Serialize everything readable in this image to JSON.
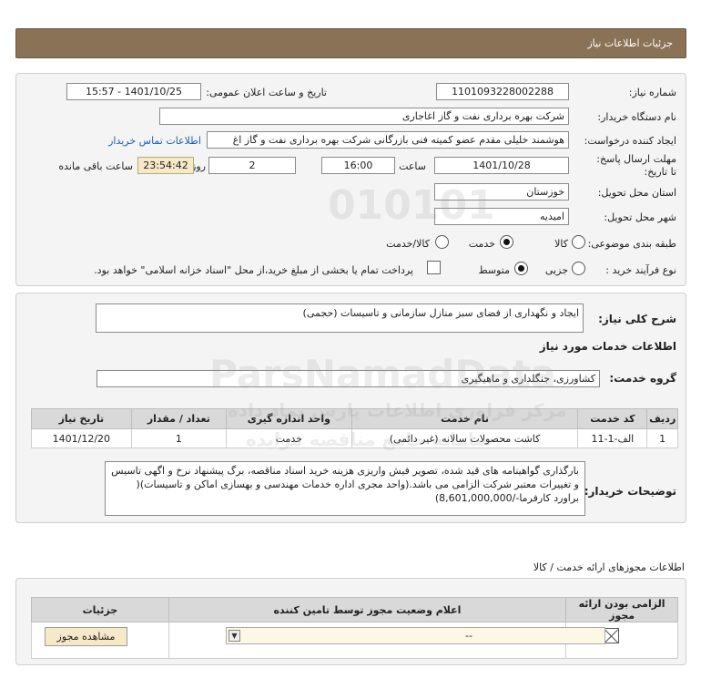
{
  "header": {
    "title": "جزئیات اطلاعات نیاز"
  },
  "form": {
    "need_number_label": "شماره نیاز:",
    "need_number": "1101093228002288",
    "announce_label": "تاریخ و ساعت اعلان عمومی:",
    "announce_value": "1401/10/25 - 15:57",
    "buyer_label": "نام دستگاه خریدار:",
    "buyer_value": "شرکت بهره برداری نفت و گاز اغاجاری",
    "creator_label": "ایجاد کننده درخواست:",
    "creator_value": "هوشمند خلیلی مقدم عضو کمیته فنی بازرگانی شرکت بهره برداری نفت و گاز اغ",
    "contact_link": "اطلاعات تماس خریدار",
    "deadline_label": "مهلت ارسال پاسخ: تا تاریخ:",
    "deadline_date": "1401/10/28",
    "time_label": "ساعت",
    "deadline_time": "16:00",
    "days_value": "2",
    "days_label": "روز و",
    "remaining_time": "23:54:42",
    "remaining_label": "ساعت باقی مانده",
    "province_label": "استان محل تحویل:",
    "province_value": "خوزستان",
    "city_label": "شهر محل تحویل:",
    "city_value": "امیدیه",
    "category_label": "طبقه بندی موضوعی:",
    "category_options": [
      "کالا",
      "خدمت",
      "کالا/خدمت"
    ],
    "purchase_type_label": "نوع فرآیند خرید :",
    "purchase_options": [
      "جزیی",
      "متوسط"
    ],
    "payment_note": "پرداخت تمام یا بخشی از مبلغ خرید،از محل \"اسناد خزانه اسلامی\" خواهد بود."
  },
  "summary": {
    "label": "شرح کلی نیاز:",
    "value": "ایجاد و نگهداری از فضای سبز منازل سازمانی و تاسیسات (حجمی)"
  },
  "services": {
    "section_title": "اطلاعات خدمات مورد نیاز",
    "group_label": "گروه خدمت:",
    "group_value": "کشاورزی، جنگلداری و ماهیگیری",
    "table": {
      "headers": [
        "ردیف",
        "کد خدمت",
        "نام خدمت",
        "واحد اندازه گیری",
        "تعداد / مقدار",
        "تاریخ نیاز"
      ],
      "rows": [
        [
          "1",
          "الف-1-11",
          "کاشت محصولات سالانه (غیر دائمی)",
          "خدمت",
          "1",
          "1401/12/20"
        ]
      ]
    },
    "buyer_notes_label": "توضیحات خریدار:",
    "buyer_notes": "بارگذاری گواهینامه های قید شده، تصویر فیش واریزی هزینه خرید اسناد مناقصه، برگ پیشنهاد نرخ و اگهی تاسیس و تغییرات معتبر شرکت الزامی می باشد.(واحد مجری اداره خدمات مهندسی و بهسازی اماکن و تاسیسات)( براورد کارفرما-/8,601,000,000)"
  },
  "permits": {
    "section_title": "اطلاعات مجوزهای ارائه خدمت / کالا",
    "headers": [
      "الزامی بودن ارائه مجوز",
      "اعلام وضعیت مجوز توسط تامین کننده",
      "جزئیات"
    ],
    "select_value": "--",
    "view_button": "مشاهده مجوز"
  },
  "watermarks": [
    "010101",
    "ParsNamadData",
    "مرکز فراوری اطلاعات پارس نماد داده",
    "سامانه جامع مناقصه مزایده"
  ]
}
